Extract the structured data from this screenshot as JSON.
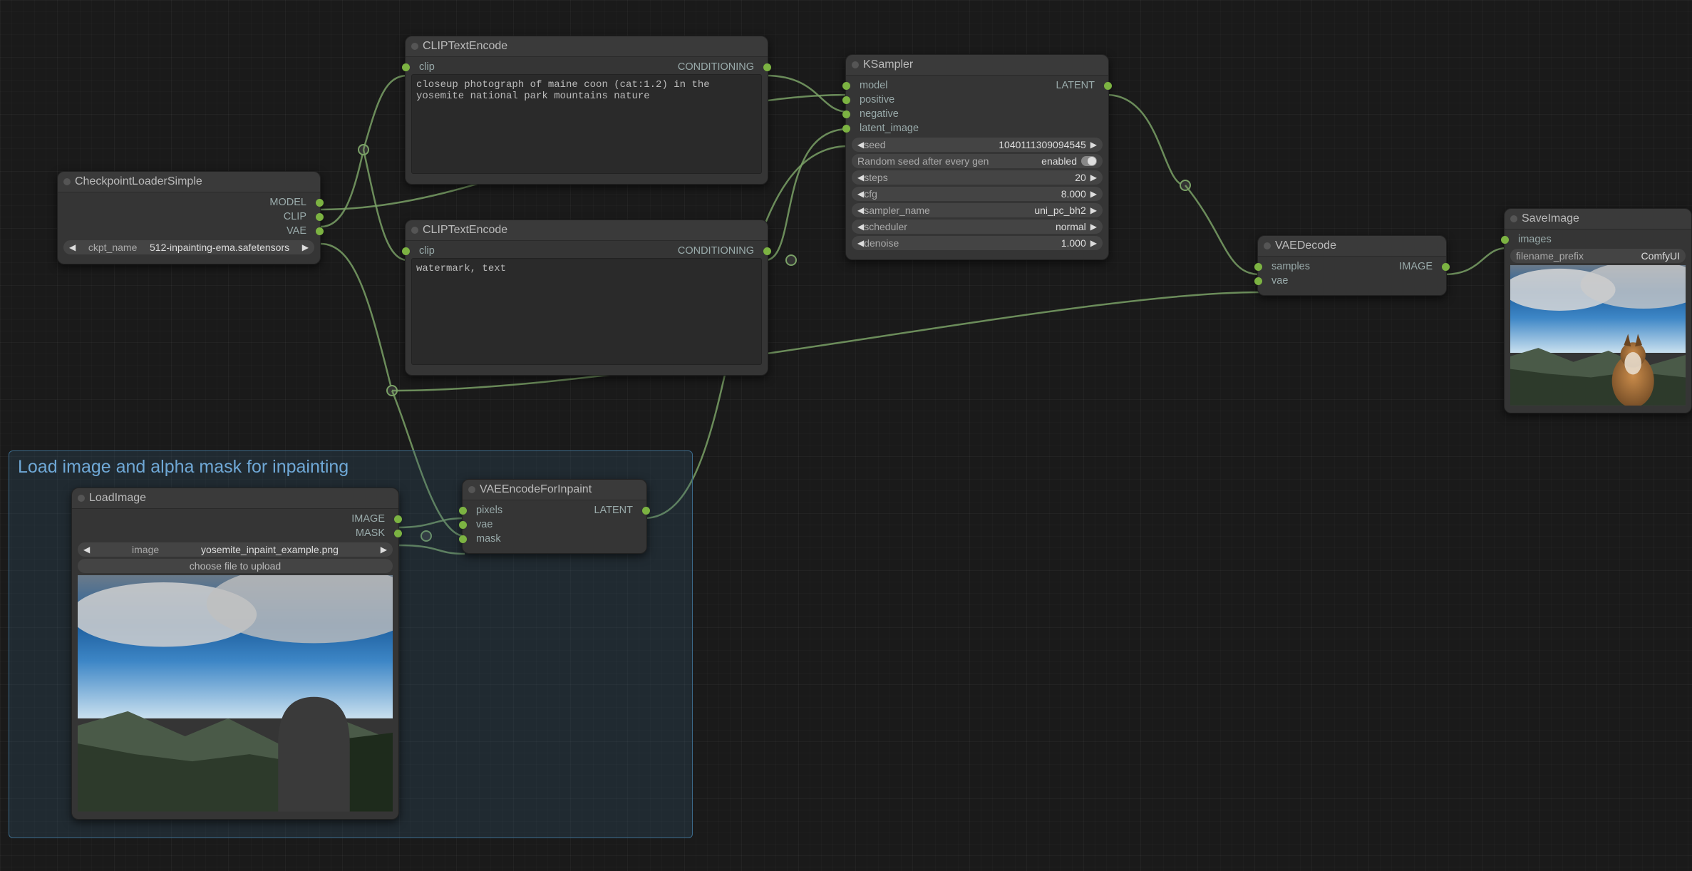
{
  "group": {
    "title": "Load image and alpha mask for inpainting"
  },
  "nodes": {
    "checkpoint": {
      "title": "CheckpointLoaderSimple",
      "outputs": {
        "model": "MODEL",
        "clip": "CLIP",
        "vae": "VAE"
      },
      "widget": {
        "label": "ckpt_name",
        "value": "512-inpainting-ema.safetensors"
      }
    },
    "clip1": {
      "title": "CLIPTextEncode",
      "inputs": {
        "clip": "clip"
      },
      "outputs": {
        "conditioning": "CONDITIONING"
      },
      "text": "closeup photograph of maine coon (cat:1.2) in the yosemite national park mountains nature"
    },
    "clip2": {
      "title": "CLIPTextEncode",
      "inputs": {
        "clip": "clip"
      },
      "outputs": {
        "conditioning": "CONDITIONING"
      },
      "text": "watermark, text"
    },
    "loadimg": {
      "title": "LoadImage",
      "outputs": {
        "image": "IMAGE",
        "mask": "MASK"
      },
      "widget_image": {
        "label": "image",
        "value": "yosemite_inpaint_example.png"
      },
      "button": "choose file to upload"
    },
    "vaeenc": {
      "title": "VAEEncodeForInpaint",
      "inputs": {
        "pixels": "pixels",
        "vae": "vae",
        "mask": "mask"
      },
      "outputs": {
        "latent": "LATENT"
      }
    },
    "ksampler": {
      "title": "KSampler",
      "inputs": {
        "model": "model",
        "positive": "positive",
        "negative": "negative",
        "latent_image": "latent_image"
      },
      "outputs": {
        "latent": "LATENT"
      },
      "widgets": {
        "seed": {
          "label": "seed",
          "value": "1040111309094545"
        },
        "random": {
          "label": "Random seed after every gen",
          "value": "enabled"
        },
        "steps": {
          "label": "steps",
          "value": "20"
        },
        "cfg": {
          "label": "cfg",
          "value": "8.000"
        },
        "sampler_name": {
          "label": "sampler_name",
          "value": "uni_pc_bh2"
        },
        "scheduler": {
          "label": "scheduler",
          "value": "normal"
        },
        "denoise": {
          "label": "denoise",
          "value": "1.000"
        }
      }
    },
    "vaedec": {
      "title": "VAEDecode",
      "inputs": {
        "samples": "samples",
        "vae": "vae"
      },
      "outputs": {
        "image": "IMAGE"
      }
    },
    "saveimg": {
      "title": "SaveImage",
      "inputs": {
        "images": "images"
      },
      "widget": {
        "label": "filename_prefix",
        "value": "ComfyUI"
      }
    }
  }
}
